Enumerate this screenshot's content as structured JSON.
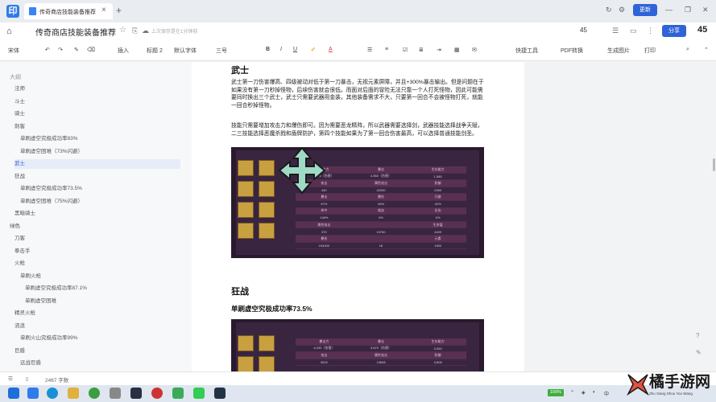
{
  "tab": {
    "title": "传奇商店技能装备推荐",
    "close": "×",
    "add": "+"
  },
  "window": {
    "update_label": "更新",
    "minimize": "—",
    "restore": "❐",
    "close": "✕"
  },
  "titlebar": {
    "title": "传奇商店技能装备推荐",
    "saved_text": "上次保存是在1分钟前",
    "badge": "45",
    "share_label": "分享",
    "user_badge": "45"
  },
  "toolbar": {
    "items": [
      "宋体",
      "插入",
      "标题 2",
      "默认字体",
      "三号",
      "B",
      "I",
      "U",
      "A",
      "快捷工具",
      "PDF转换",
      "生成图片",
      "打印"
    ]
  },
  "sidebar": {
    "head": "大纲",
    "items": [
      "法师",
      "斗士",
      "骑士",
      "刺客",
      "单刷虚空究极成功率83%",
      "单刷虚空困难（73%闪避）",
      "武士",
      "狂战",
      "单刷虚空究极成功率73.5%",
      "单刷虚空困难（75%闪避）",
      "黑暗骑士",
      "绿色",
      "刀客",
      "拳击手",
      "火枪",
      "单刷火枪",
      "单刷虚空究极成功率87.1%",
      "单刷虚空困难",
      "精灵火枪",
      "流浪",
      "单刷火山究极成功率99%",
      "巨盾",
      "远战巨盾"
    ],
    "active_index": 6
  },
  "doc": {
    "h_wushi": "武士",
    "p1": "武士第一刀伤害爆高、四级被动对低于第一刀暴击，无视元素屏障，并且+300%暴击输出。但是问题在于如果没有第一刀秒掉怪物，后续伤害就会很低。而面对后面的冒险无法只靠一个人打死怪物，因此可能需要同时换出三个武士，武士只需要武器用金装，其他装备需求不大，只要第一回合不会被怪物打死，就能一回合秒掉怪物。",
    "p2": "技能只需要增加攻击力和爆伤即可。因为需要恶龙精阵，所以武器需要选择剑，武器技能选择战争天赋，二三技能选择恶魔杀戮和盾牌防护，第四个技能如果为了第一回合伤害最高，可以选择普通技能剑圣。",
    "h_kuangzhan": "狂战",
    "h3_kz": "单刷虚空究极成功率73.5%",
    "stats1": [
      [
        "暴击力",
        "暴击",
        "生存能力"
      ],
      [
        "3976（伤害）",
        "4,560（伤害）",
        "1,580"
      ],
      [
        "攻击",
        "属性攻击",
        "防御"
      ],
      [
        "440",
        "42000",
        "2490"
      ],
      [
        "暴击",
        "暴伤",
        "闪避"
      ],
      [
        "57%",
        "49%",
        "42%"
      ],
      [
        "命中",
        "吸血",
        "反伤"
      ],
      [
        "148%",
        "0%",
        "0%"
      ],
      [
        "属性攻击",
        "",
        "生命值"
      ],
      [
        "370",
        "19780",
        "4409"
      ],
      [
        "暴伤",
        "",
        "元素"
      ],
      [
        "244000",
        "18",
        "1900"
      ]
    ],
    "stats2": [
      [
        "暴击力",
        "暴击",
        "生存能力"
      ],
      [
        "4,030（伤害）",
        "3,870（伤害）",
        "3,060"
      ],
      [
        "攻击",
        "属性攻击",
        "防御"
      ],
      [
        "3515",
        "13608",
        "3,808"
      ]
    ]
  },
  "status": {
    "pages": "2467 字数",
    "zoom": "100%",
    "time": ""
  },
  "colors": {
    "accent": "#2f64d8",
    "game_bg": "#3a2540"
  },
  "watermark": {
    "title": "橘手游网",
    "subtitle": "Zhu Xiang Shou You Wang"
  }
}
